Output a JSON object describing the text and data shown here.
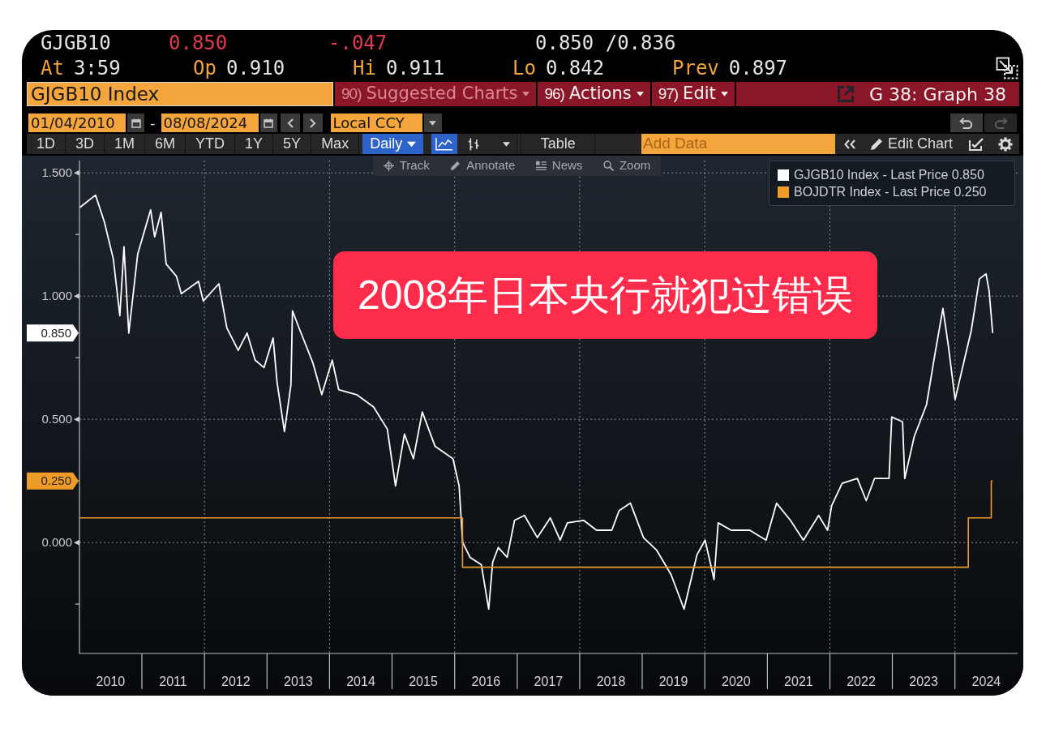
{
  "quote": {
    "ticker": "GJGB10",
    "last": "0.850",
    "change": "-.047",
    "bid_ask": "0.850 /0.836"
  },
  "stats": [
    {
      "label": "At",
      "value": "3:59"
    },
    {
      "label": "Op",
      "value": "0.910"
    },
    {
      "label": "Hi",
      "value": "0.911"
    },
    {
      "label": "Lo",
      "value": "0.842"
    },
    {
      "label": "Prev",
      "value": "0.897"
    }
  ],
  "security": {
    "value": "GJGB10 Index"
  },
  "menus": [
    {
      "number": "90)",
      "label": "Suggested Charts",
      "disabled": true
    },
    {
      "number": "96)",
      "label": "Actions",
      "disabled": false
    },
    {
      "number": "97)",
      "label": "Edit",
      "disabled": false
    }
  ],
  "graph_title": "G 38: Graph 38",
  "date_range": {
    "start": "01/04/2010",
    "separator": "-",
    "end": "08/08/2024"
  },
  "currency": {
    "value": "Local CCY"
  },
  "history": [
    {
      "kind": "undo",
      "disabled": false
    },
    {
      "kind": "redo",
      "disabled": true
    }
  ],
  "periods": [
    {
      "label": "1D",
      "selected": false
    },
    {
      "label": "3D",
      "selected": false
    },
    {
      "label": "1M",
      "selected": false
    },
    {
      "label": "6M",
      "selected": false
    },
    {
      "label": "YTD",
      "selected": false
    },
    {
      "label": "1Y",
      "selected": false
    },
    {
      "label": "5Y",
      "selected": false
    },
    {
      "label": "Max",
      "selected": false
    }
  ],
  "frequency": {
    "label": "Daily"
  },
  "chart_types": [
    {
      "kind": "line",
      "selected": true
    },
    {
      "kind": "bars",
      "selected": false
    }
  ],
  "table_button": {
    "label": "Table"
  },
  "add_data": {
    "placeholder": "Add Data"
  },
  "edit_chart": {
    "label": "Edit Chart"
  },
  "chart": {
    "tools": [
      {
        "kind": "track",
        "label": "Track"
      },
      {
        "kind": "annotate",
        "label": "Annotate"
      },
      {
        "kind": "news",
        "label": "News"
      },
      {
        "kind": "zoom",
        "label": "Zoom"
      }
    ],
    "chart_data": [
      {
        "type": "line",
        "xlim": [
          "2010-01-01",
          "2025-01-01"
        ],
        "ylim": [
          -0.45,
          1.55
        ],
        "grid": true,
        "legend": "upper right",
        "annotations": [
          "0.850",
          "0.250"
        ],
        "yticks": [
          {
            "value": 0,
            "label": "0.000"
          },
          {
            "value": 0.5,
            "label": "0.500"
          },
          {
            "value": 1,
            "label": "1.000"
          },
          {
            "value": 1.5,
            "label": "1.500"
          }
        ],
        "xticks": [
          {
            "value": "2010-07-02",
            "label": "2010"
          },
          {
            "value": "2011-07-02",
            "label": "2011"
          },
          {
            "value": "2012-07-02",
            "label": "2012"
          },
          {
            "value": "2013-07-02",
            "label": "2013"
          },
          {
            "value": "2014-07-02",
            "label": "2014"
          },
          {
            "value": "2015-07-02",
            "label": "2015"
          },
          {
            "value": "2016-07-02",
            "label": "2016"
          },
          {
            "value": "2017-07-02",
            "label": "2017"
          },
          {
            "value": "2018-07-02",
            "label": "2018"
          },
          {
            "value": "2019-07-02",
            "label": "2019"
          },
          {
            "value": "2020-07-02",
            "label": "2020"
          },
          {
            "value": "2021-07-02",
            "label": "2021"
          },
          {
            "value": "2022-07-02",
            "label": "2022"
          },
          {
            "value": "2023-07-02",
            "label": "2023"
          },
          {
            "value": "2024-07-02",
            "label": "2024"
          }
        ],
        "series": [
          {
            "name": "GJGB10 Index - Last Price 0.850",
            "color": "#ffffff",
            "x": [
              "2010-01-04",
              "2010-04-05",
              "2010-05-27",
              "2010-07-18",
              "2010-08-25",
              "2010-09-18",
              "2010-10-16",
              "2010-12-07",
              "2011-02-21",
              "2011-03-16",
              "2011-04-23",
              "2011-05-22",
              "2011-07-22",
              "2011-08-19",
              "2011-11-27",
              "2011-12-25",
              "2012-03-25",
              "2012-05-11",
              "2012-07-16",
              "2012-09-06",
              "2012-10-23",
              "2012-12-14",
              "2013-02-05",
              "2013-02-28",
              "2013-04-12",
              "2013-05-20",
              "2013-05-29",
              "2013-07-07",
              "2013-09-25",
              "2013-11-16",
              "2014-01-16",
              "2014-02-23",
              "2014-06-08",
              "2014-09-15",
              "2014-12-04",
              "2015-01-21",
              "2015-03-14",
              "2015-05-05",
              "2015-06-26",
              "2015-09-09",
              "2015-12-22",
              "2016-01-27",
              "2016-02-17",
              "2016-03-31",
              "2016-06-05",
              "2016-07-18",
              "2016-08-10",
              "2016-09-12",
              "2016-11-03",
              "2016-12-16",
              "2017-02-12",
              "2017-04-28",
              "2017-07-13",
              "2017-09-08",
              "2017-10-21",
              "2018-01-23",
              "2018-04-09",
              "2018-07-07",
              "2018-08-19",
              "2018-10-24",
              "2019-01-08",
              "2019-03-25",
              "2019-06-18",
              "2019-09-02",
              "2019-11-16",
              "2020-01-03",
              "2020-02-24",
              "2020-03-19",
              "2020-06-03",
              "2020-09-20",
              "2020-12-24",
              "2021-02-23",
              "2021-05-15",
              "2021-07-30",
              "2021-10-27",
              "2021-12-18",
              "2022-01-11",
              "2022-03-13",
              "2022-06-10",
              "2022-08-01",
              "2022-09-18",
              "2022-12-12",
              "2022-12-28",
              "2023-03-01",
              "2023-03-14",
              "2023-05-08",
              "2023-07-19",
              "2023-09-05",
              "2023-10-23",
              "2023-11-25",
              "2024-01-02",
              "2024-02-18",
              "2024-04-05",
              "2024-05-23",
              "2024-07-01",
              "2024-07-19",
              "2024-08-08"
            ],
            "values": [
              1.36,
              1.41,
              1.3,
              1.15,
              0.92,
              1.2,
              0.85,
              1.17,
              1.35,
              1.24,
              1.34,
              1.13,
              1.08,
              1.01,
              1.06,
              0.98,
              1.05,
              0.87,
              0.78,
              0.85,
              0.74,
              0.71,
              0.83,
              0.65,
              0.45,
              0.64,
              0.94,
              0.87,
              0.73,
              0.6,
              0.74,
              0.62,
              0.6,
              0.55,
              0.46,
              0.23,
              0.44,
              0.34,
              0.53,
              0.39,
              0.34,
              0.23,
              0.0,
              -0.06,
              -0.09,
              -0.27,
              -0.08,
              -0.02,
              -0.06,
              0.09,
              0.11,
              0.02,
              0.1,
              0.01,
              0.08,
              0.09,
              0.05,
              0.05,
              0.13,
              0.16,
              0.02,
              -0.03,
              -0.13,
              -0.27,
              -0.05,
              0.01,
              -0.15,
              0.08,
              0.05,
              0.05,
              0.01,
              0.16,
              0.09,
              0.01,
              0.11,
              0.05,
              0.15,
              0.24,
              0.26,
              0.17,
              0.26,
              0.26,
              0.51,
              0.49,
              0.26,
              0.43,
              0.56,
              0.76,
              0.95,
              0.79,
              0.58,
              0.72,
              0.86,
              1.07,
              1.09,
              1.02,
              0.85
            ]
          },
          {
            "name": "BOJDTR Index - Last Price 0.250",
            "type": "step",
            "color": "#ef9b28",
            "x": [
              "2010-01-04",
              "2016-02-16",
              "2024-03-19",
              "2024-07-31",
              "2024-08-08"
            ],
            "values": [
              0.1,
              -0.1,
              0.1,
              0.25,
              0.25
            ]
          }
        ]
      }
    ]
  },
  "caption": "2008年日本央行就犯过错误"
}
